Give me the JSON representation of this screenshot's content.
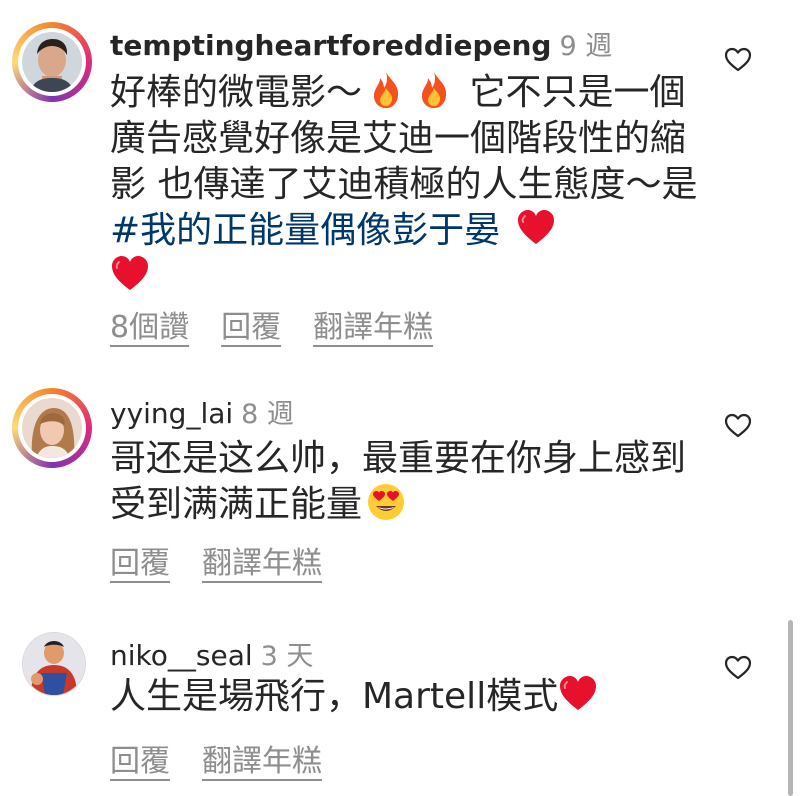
{
  "comments": [
    {
      "username": "temptingheartforeddiepeng",
      "time": "9 週",
      "text_parts": [
        "好棒的微電影～",
        "  它不只是一個廣告感覺好像是艾迪一個階段性的縮影 也傳達了艾迪積極的人生態度～是",
        "#我的正能量偶像彭于晏",
        " "
      ],
      "emojis": [
        "fire-emoji",
        "fire-emoji",
        "heart-emoji",
        "heart-emoji"
      ],
      "actions": {
        "likes": "8個讚",
        "reply": "回覆",
        "translate": "翻譯年糕"
      }
    },
    {
      "username": "yying_lai",
      "time": "8 週",
      "text_parts": [
        "哥还是这么帅，最重要在你身上感到受到满满正能量"
      ],
      "emojis": [
        "heart-eyes-emoji"
      ],
      "actions": {
        "reply": "回覆",
        "translate": "翻譯年糕"
      }
    },
    {
      "username": "niko__seal",
      "time": "3 天",
      "text_parts": [
        "人生是場飛行，Martell模式"
      ],
      "emojis": [
        "heart-emoji"
      ],
      "actions": {
        "reply": "回覆",
        "translate": "翻譯年糕"
      }
    }
  ],
  "colors": {
    "text": "#262626",
    "secondary": "#8e8e8e",
    "hashtag": "#00376b",
    "heart": "#e8112d"
  }
}
